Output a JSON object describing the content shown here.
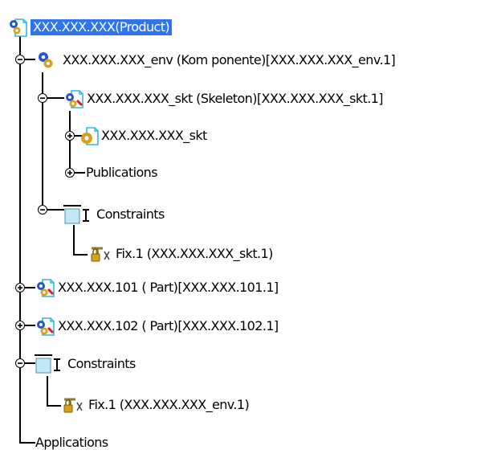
{
  "tree": {
    "root": {
      "label": "XXX.XXX.XXX(Product)",
      "icon": "product-icon",
      "selected": true
    },
    "nodes": [
      {
        "label": "XXX.XXX.XXX_env (Kom ponente)[XXX.XXX.XXX_env.1]",
        "icon": "component-icon",
        "expander": "minus"
      },
      {
        "label": "XXX.XXX.XXX_skt (Skeleton)[XXX.XXX.XXX_skt.1]",
        "icon": "part-icon",
        "expander": "minus"
      },
      {
        "label": "XXX.XXX.XXX_skt",
        "icon": "part-body-icon",
        "expander": "plus"
      },
      {
        "label": "Publications",
        "icon": "",
        "expander": "plus"
      },
      {
        "label": "Constraints",
        "icon": "constraints-icon",
        "expander": "minus"
      },
      {
        "label": "Fix.1 (XXX.XXX.XXX_skt.1)",
        "icon": "fix-constraint-icon",
        "expander": ""
      },
      {
        "label": "XXX.XXX.101 ( Part)[XXX.XXX.101.1]",
        "icon": "part-icon",
        "expander": "plus"
      },
      {
        "label": "XXX.XXX.102 ( Part)[XXX.XXX.102.1]",
        "icon": "part-icon",
        "expander": "plus"
      },
      {
        "label": "Constraints",
        "icon": "constraints-icon",
        "expander": "minus"
      },
      {
        "label": "Fix.1 (XXX.XXX.XXX_env.1)",
        "icon": "fix-constraint-icon",
        "expander": ""
      },
      {
        "label": "Applications",
        "icon": "",
        "expander": ""
      }
    ]
  },
  "colors": {
    "selection": "#2f73ef",
    "gear_blue": "#2456c8",
    "gear_gold": "#d7a21a",
    "doc_cyan": "#35b6dc",
    "constraint_fill": "#bfe9f6"
  }
}
